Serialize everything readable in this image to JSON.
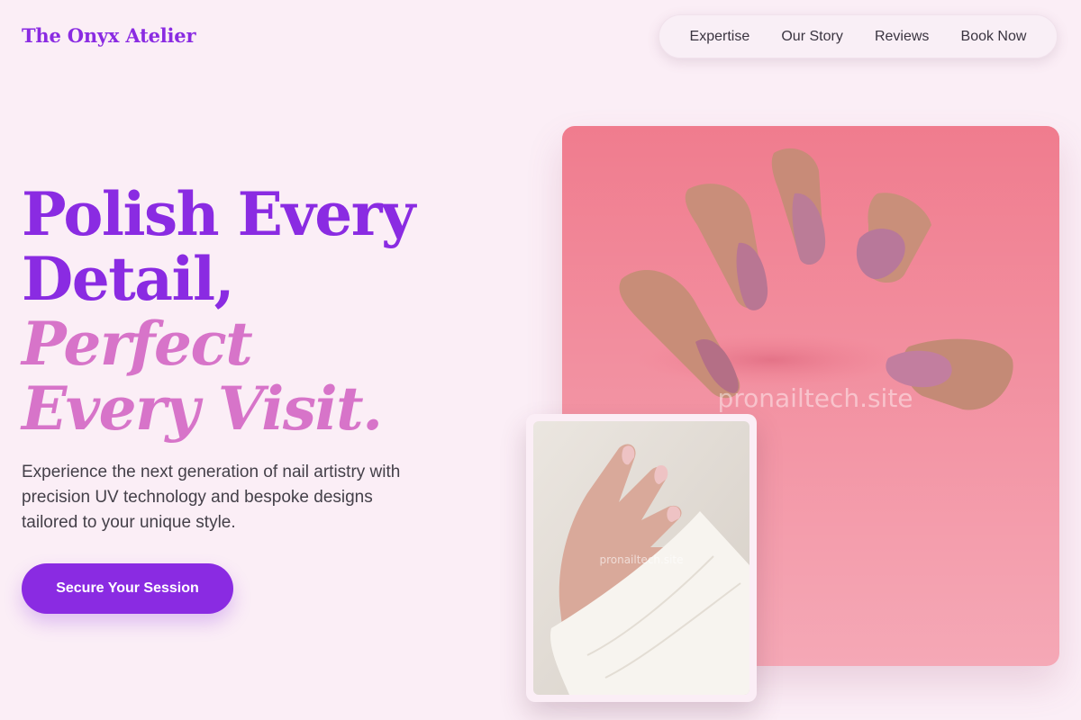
{
  "brand": {
    "name": "The Onyx Atelier"
  },
  "nav": {
    "items": [
      {
        "label": "Expertise"
      },
      {
        "label": "Our Story"
      },
      {
        "label": "Reviews"
      },
      {
        "label": "Book Now"
      }
    ]
  },
  "hero": {
    "title_line1": "Polish Every Detail,",
    "title_line2": "Perfect Every Visit.",
    "description": "Experience the next generation of nail artistry with precision UV technology and bespoke designs tailored to your unique style.",
    "cta_label": "Secure Your Session"
  },
  "images": {
    "main": {
      "watermark": "pronailtech.site"
    },
    "inset": {
      "watermark": "pronailtech.site"
    }
  },
  "colors": {
    "accent": "#8a2be2",
    "accent_soft": "#d774c9",
    "background": "#fbeef6",
    "photo_pink": "#f27f92"
  }
}
